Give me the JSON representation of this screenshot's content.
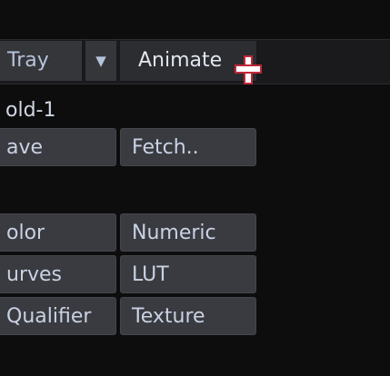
{
  "toolbar": {
    "tray_label": "Tray",
    "dropdown_icon": "▼",
    "animate_label": "Animate"
  },
  "panel": {
    "name": "old-1",
    "buttons": {
      "save": "ave",
      "fetch": "Fetch..",
      "color": "olor",
      "numeric": "Numeric",
      "curves": "urves",
      "lut": "LUT",
      "qualifier": "Qualifier",
      "texture": "Texture"
    }
  },
  "colors": {
    "background": "#0d0d0d",
    "button": "#3a3b40",
    "text": "#c9d2e4",
    "cursor": "#c0283a"
  },
  "icons": {
    "cursor": "crosshair-cursor-icon"
  }
}
